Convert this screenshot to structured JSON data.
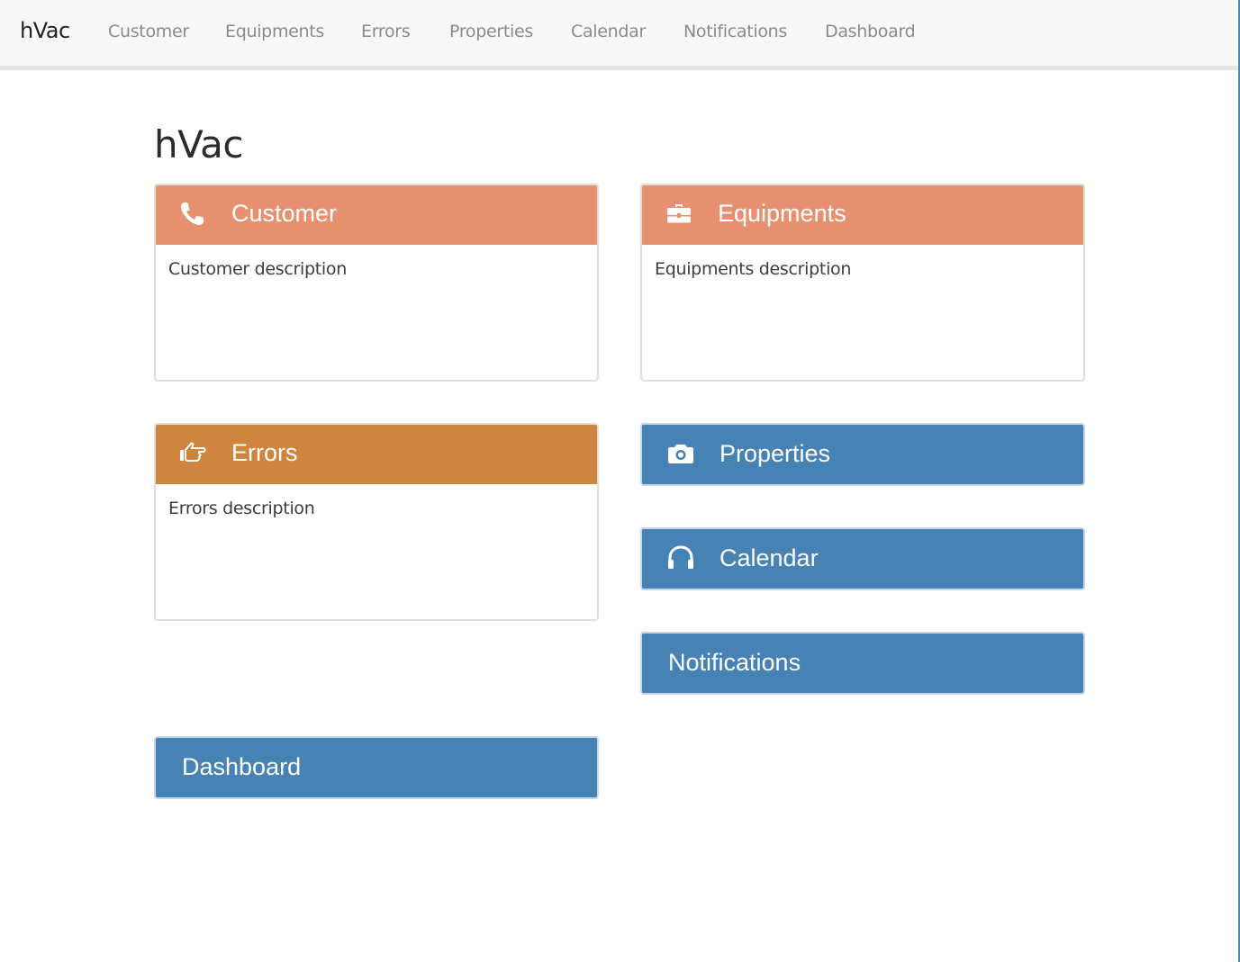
{
  "navbar": {
    "brand": "hVac",
    "links": [
      "Customer",
      "Equipments",
      "Errors",
      "Properties",
      "Calendar",
      "Notifications",
      "Dashboard"
    ]
  },
  "page": {
    "title": "hVac"
  },
  "colors": {
    "salmon": "#e89171",
    "orange": "#cd853f",
    "blue": "#4682b4"
  },
  "panels": {
    "customer": {
      "title": "Customer",
      "description": "Customer description",
      "icon": "phone-icon"
    },
    "equipments": {
      "title": "Equipments",
      "description": "Equipments description",
      "icon": "briefcase-icon"
    },
    "errors": {
      "title": "Errors",
      "description": "Errors description",
      "icon": "hand-point-right-icon"
    },
    "properties": {
      "title": "Properties",
      "icon": "camera-icon"
    },
    "calendar": {
      "title": "Calendar",
      "icon": "headphones-icon"
    },
    "notifications": {
      "title": "Notifications"
    },
    "dashboard": {
      "title": "Dashboard"
    }
  }
}
